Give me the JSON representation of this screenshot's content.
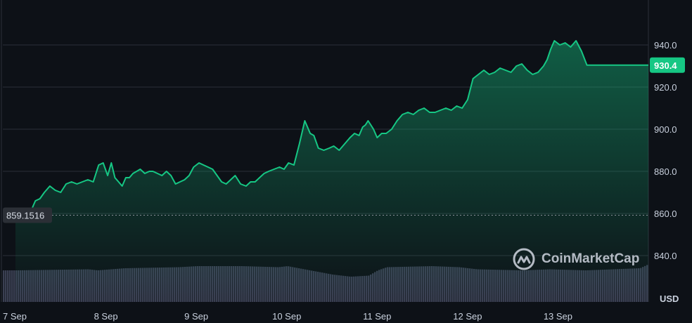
{
  "brand": {
    "name": "CoinMarketCap",
    "logo_icon": "coinmarketcap-logo-icon"
  },
  "colors": {
    "line": "#16c784",
    "area_top": "#16c784",
    "background": "#0d1117",
    "grid": "#2a2f38",
    "volume": "#3a3f52",
    "current_label_bg": "#16c784",
    "base_label_bg": "#2b2f36"
  },
  "chart_data": {
    "type": "line",
    "title": "",
    "xlabel": "",
    "ylabel": "USD",
    "unit": "USD",
    "ylim": [
      830,
      948
    ],
    "y_ticks": [
      840,
      860,
      880,
      900,
      920,
      940
    ],
    "y_tick_labels": [
      "840.0",
      "860.0",
      "880.0",
      "900.0",
      "920.0",
      "940.0"
    ],
    "grid": true,
    "x_tick_labels": [
      "7 Sep",
      "8 Sep",
      "9 Sep",
      "10 Sep",
      "11 Sep",
      "12 Sep",
      "13 Sep"
    ],
    "x_tick_days": [
      0,
      1,
      2,
      3,
      4,
      5,
      6
    ],
    "x_range_days": [
      0,
      7.0
    ],
    "baseline": {
      "value": 859.1516,
      "label": "859.1516"
    },
    "current": {
      "value": 930.4,
      "label": "930.4"
    },
    "series": [
      {
        "x_days": [
          0,
          0.06,
          0.12,
          0.18,
          0.22,
          0.27,
          0.32,
          0.38,
          0.44,
          0.5,
          0.56,
          0.62,
          0.68,
          0.74,
          0.8,
          0.86,
          0.92,
          0.97,
          1.02,
          1.06,
          1.1,
          1.14,
          1.18,
          1.22,
          1.26,
          1.3,
          1.34,
          1.38,
          1.43,
          1.48,
          1.52,
          1.57,
          1.62,
          1.67,
          1.72,
          1.77,
          1.82,
          1.87,
          1.92,
          1.97,
          2.03,
          2.08,
          2.13,
          2.18,
          2.23,
          2.28,
          2.33,
          2.38,
          2.43,
          2.49,
          2.55,
          2.6,
          2.65,
          2.7,
          2.75,
          2.8,
          2.86,
          2.92,
          2.97,
          3.02,
          3.08,
          3.14,
          3.2,
          3.26,
          3.3,
          3.35,
          3.41,
          3.47,
          3.52,
          3.58,
          3.64,
          3.7,
          3.75,
          3.8,
          3.84,
          3.87,
          3.9,
          3.93,
          3.96,
          4.0,
          4.05,
          4.1,
          4.16,
          4.22,
          4.28,
          4.34,
          4.4,
          4.46,
          4.52,
          4.58,
          4.64,
          4.7,
          4.76,
          4.82,
          4.88,
          4.94,
          5.0,
          5.06,
          5.12,
          5.18,
          5.24,
          5.3,
          5.36,
          5.42,
          5.48,
          5.54,
          5.6,
          5.66,
          5.72,
          5.78,
          5.84,
          5.88,
          5.92,
          5.96,
          6.02,
          6.08,
          6.14,
          6.2,
          6.26,
          6.32,
          6.38,
          6.44,
          6.5,
          6.56,
          6.62,
          6.66,
          6.72,
          6.78,
          6.84,
          6.88,
          6.92,
          6.96,
          7.0
        ],
        "values": [
          861,
          859.5,
          860,
          862,
          866,
          867,
          870,
          873,
          871,
          870,
          874,
          875,
          874,
          875,
          876,
          875,
          883,
          884,
          878,
          884,
          877,
          875,
          873,
          877,
          877,
          879,
          880,
          881,
          879,
          880,
          880,
          879,
          878,
          880,
          878,
          874,
          875,
          876,
          878,
          882,
          884,
          883,
          882,
          881,
          878,
          875,
          874,
          876,
          878,
          874,
          873,
          875,
          875,
          877,
          879,
          880,
          881,
          882,
          881,
          884,
          883,
          893,
          904,
          898,
          897,
          891,
          890,
          891,
          892,
          890,
          893,
          896,
          898,
          897,
          901,
          902,
          904,
          902,
          900,
          896,
          898,
          898,
          900,
          904,
          907,
          908,
          907,
          909,
          910,
          908,
          908,
          909,
          910,
          909,
          911,
          910,
          914,
          924,
          926,
          928,
          926,
          927,
          929,
          928,
          927,
          930,
          931,
          928,
          926,
          927,
          930,
          933,
          938,
          942,
          940,
          941,
          939,
          942,
          937,
          930.4,
          930.4,
          930.4,
          930.4,
          930.4,
          930.4,
          930.4,
          930.4,
          930.4,
          930.4,
          930.4,
          930.4,
          930.4,
          930.4
        ]
      }
    ],
    "volume": {
      "x_days": [
        0,
        0.8,
        0.9,
        1.2,
        1.8,
        2.0,
        2.5,
        2.9,
        3.0,
        3.5,
        3.7,
        3.9,
        4.0,
        4.1,
        4.6,
        4.9,
        5.1,
        5.6,
        5.9,
        6.3,
        6.6,
        6.9,
        7.0
      ],
      "values": [
        30,
        31,
        30,
        32,
        33,
        34,
        34,
        33,
        34,
        26,
        24,
        25,
        30,
        33,
        34,
        33,
        31,
        30,
        31,
        30,
        31,
        32,
        36
      ]
    }
  }
}
